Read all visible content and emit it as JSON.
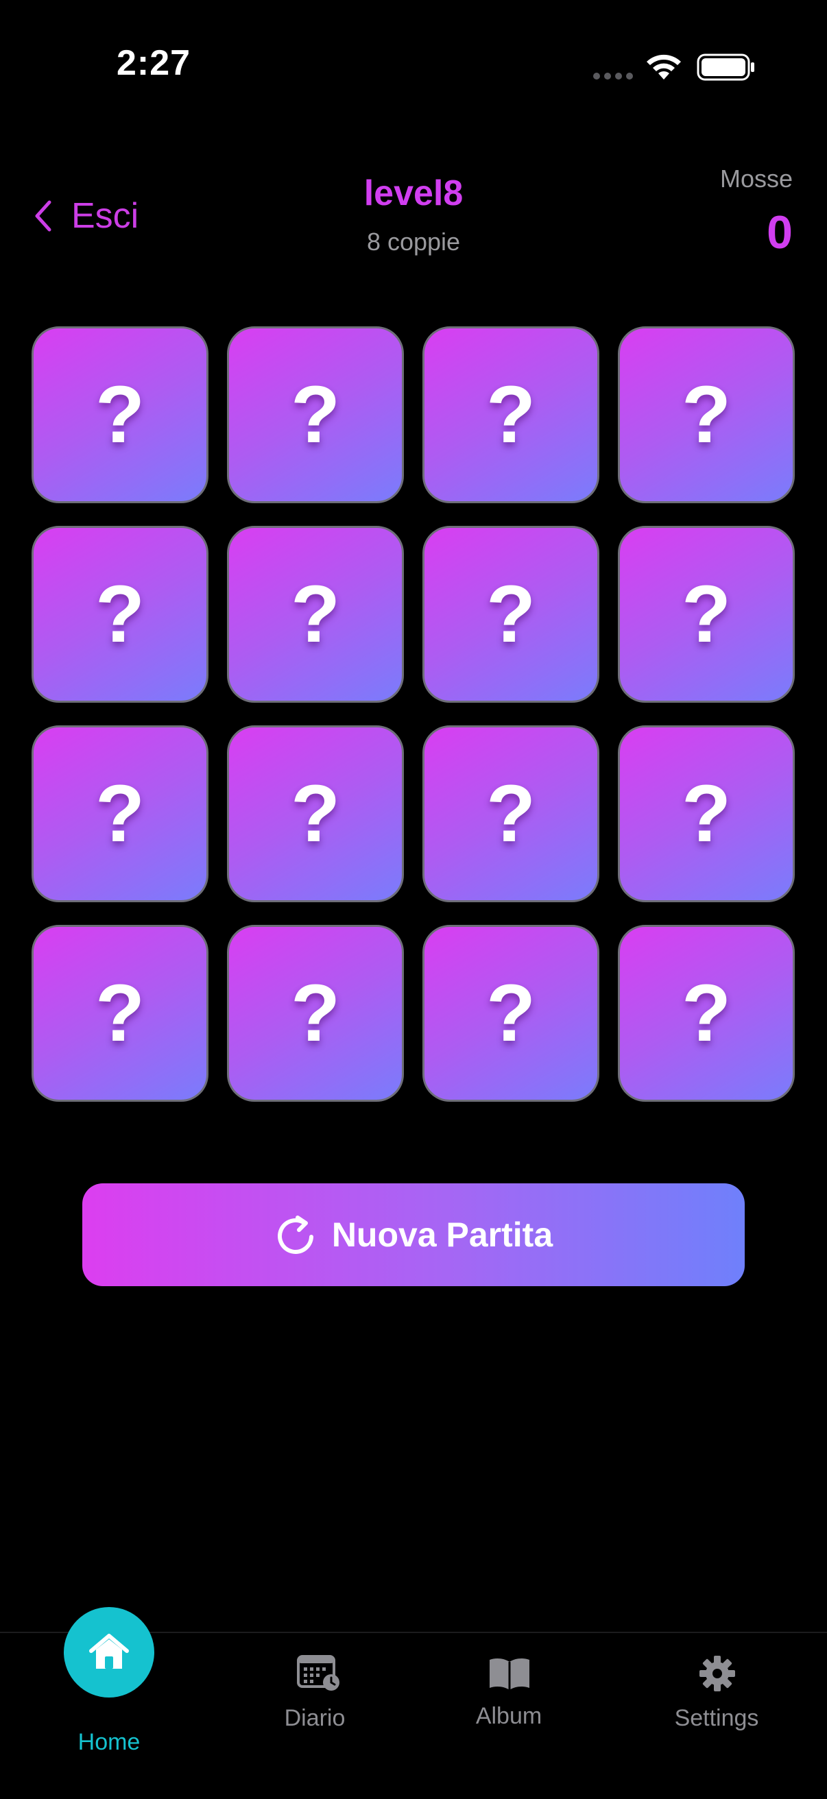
{
  "status_bar": {
    "time": "2:27",
    "icons": [
      "signal-dots-icon",
      "wifi-icon",
      "battery-icon"
    ]
  },
  "header": {
    "back_label": "Esci",
    "level_title": "level8",
    "level_subtitle": "8 coppie",
    "moves_label": "Mosse",
    "moves_value": "0"
  },
  "grid": {
    "cards": [
      {
        "glyph": "?"
      },
      {
        "glyph": "?"
      },
      {
        "glyph": "?"
      },
      {
        "glyph": "?"
      },
      {
        "glyph": "?"
      },
      {
        "glyph": "?"
      },
      {
        "glyph": "?"
      },
      {
        "glyph": "?"
      },
      {
        "glyph": "?"
      },
      {
        "glyph": "?"
      },
      {
        "glyph": "?"
      },
      {
        "glyph": "?"
      },
      {
        "glyph": "?"
      },
      {
        "glyph": "?"
      },
      {
        "glyph": "?"
      },
      {
        "glyph": "?"
      }
    ]
  },
  "new_game": {
    "label": "Nuova Partita",
    "icon": "refresh-icon"
  },
  "tab_bar": {
    "tabs": [
      {
        "label": "Home",
        "icon": "home-icon",
        "active": true
      },
      {
        "label": "Diario",
        "icon": "calendar-icon",
        "active": false
      },
      {
        "label": "Album",
        "icon": "book-icon",
        "active": false
      },
      {
        "label": "Settings",
        "icon": "gear-icon",
        "active": false
      }
    ]
  },
  "colors": {
    "accent": "#d13ef0",
    "card_gradient_start": "#d93ef2",
    "card_gradient_end": "#7a7cfb",
    "tab_active": "#15c2cf",
    "tab_inactive": "#8e8e93",
    "background": "#000000"
  }
}
